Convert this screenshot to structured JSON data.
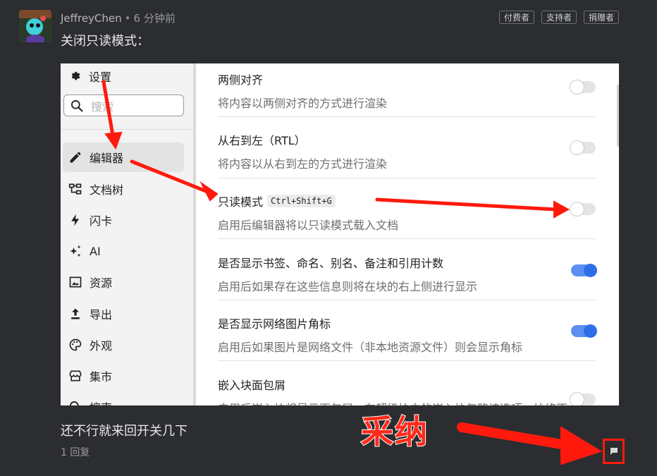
{
  "post": {
    "author": "JeffreyChen",
    "separator": "•",
    "time": "6 分钟前",
    "badges": [
      "付费者",
      "支持者",
      "捐赠者"
    ],
    "text": "关闭只读模式："
  },
  "settings": {
    "header": "设置",
    "search_placeholder": "搜索",
    "nav": [
      {
        "label": "编辑器",
        "icon": "pencil-icon",
        "active": true
      },
      {
        "label": "文档树",
        "icon": "doc-tree-icon"
      },
      {
        "label": "闪卡",
        "icon": "lightning-icon"
      },
      {
        "label": "AI",
        "icon": "sparkle-icon"
      },
      {
        "label": "资源",
        "icon": "image-icon"
      },
      {
        "label": "导出",
        "icon": "upload-icon"
      },
      {
        "label": "外观",
        "icon": "palette-icon"
      },
      {
        "label": "集市",
        "icon": "store-icon"
      },
      {
        "label": "搜索",
        "icon": "search-icon"
      }
    ],
    "rows": [
      {
        "title": "两侧对齐",
        "desc": "将内容以两侧对齐的方式进行渲染",
        "on": false
      },
      {
        "title": "从右到左（RTL）",
        "desc": "将内容以从右到左的方式进行渲染",
        "on": false
      },
      {
        "title": "只读模式",
        "shortcut": "Ctrl+Shift+G",
        "desc": "启用后编辑器将以只读模式载入文档",
        "on": false
      },
      {
        "title": "是否显示书签、命名、别名、备注和引用计数",
        "desc": "启用后如果存在这些信息则将在块的右上侧进行显示",
        "on": true
      },
      {
        "title": "是否显示网络图片角标",
        "desc": "启用后如果图片是网络文件（非本地资源文件）则会显示角标",
        "on": true
      },
      {
        "title": "嵌入块面包屑",
        "desc": "启用后嵌入块将显示面包屑，在超级块中的嵌入块忽略该选项，始终不",
        "on": false
      }
    ]
  },
  "reply": {
    "text": "还不行就来回开关几下",
    "count": "1 回复"
  },
  "annotation": {
    "accept_label": "采纳",
    "arrow_color": "#ff1a0d"
  }
}
